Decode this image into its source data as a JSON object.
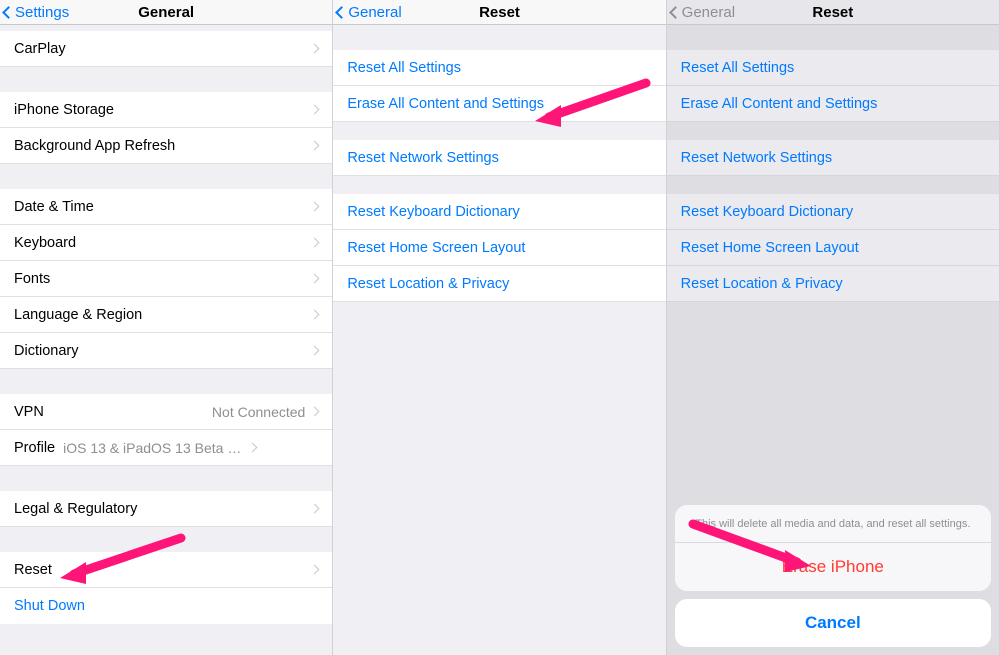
{
  "panel1": {
    "back": "Settings",
    "title": "General",
    "rows": {
      "carplay": "CarPlay",
      "iphone_storage": "iPhone Storage",
      "bg_refresh": "Background App Refresh",
      "date_time": "Date & Time",
      "keyboard": "Keyboard",
      "fonts": "Fonts",
      "lang_region": "Language & Region",
      "dictionary": "Dictionary",
      "vpn": "VPN",
      "vpn_value": "Not Connected",
      "profile": "Profile",
      "profile_value": "iOS 13 & iPadOS 13 Beta Software Pr...",
      "legal": "Legal & Regulatory",
      "reset": "Reset",
      "shutdown": "Shut Down"
    }
  },
  "panel2": {
    "back": "General",
    "title": "Reset",
    "rows": {
      "reset_all": "Reset All Settings",
      "erase_all": "Erase All Content and Settings",
      "reset_network": "Reset Network Settings",
      "reset_keyboard": "Reset Keyboard Dictionary",
      "reset_home": "Reset Home Screen Layout",
      "reset_location": "Reset Location & Privacy"
    }
  },
  "panel3": {
    "back": "General",
    "title": "Reset",
    "rows": {
      "reset_all": "Reset All Settings",
      "erase_all": "Erase All Content and Settings",
      "reset_network": "Reset Network Settings",
      "reset_keyboard": "Reset Keyboard Dictionary",
      "reset_home": "Reset Home Screen Layout",
      "reset_location": "Reset Location & Privacy"
    },
    "sheet": {
      "message": "This will delete all media and data, and reset all settings.",
      "erase": "Erase iPhone",
      "cancel": "Cancel"
    }
  }
}
